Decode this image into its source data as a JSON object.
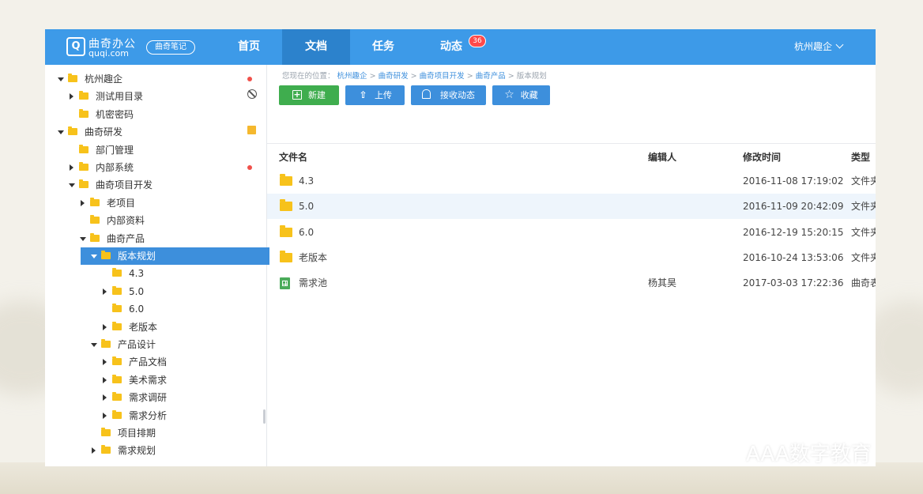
{
  "app": {
    "logo_mark": "Q",
    "logo_text": "曲奇办公",
    "logo_subtext": "quqi.com",
    "note_label": "曲奇笔记"
  },
  "nav": {
    "home": "首页",
    "docs": "文档",
    "tasks": "任务",
    "activity": "动态",
    "activity_badge": "36",
    "user": "杭州趣企"
  },
  "tree": [
    {
      "label": "杭州趣企",
      "caret": "down",
      "flag": "dot"
    },
    {
      "label": "测试用目录",
      "caret": "right",
      "flag": "ban"
    },
    {
      "label": "机密密码",
      "caret": "none",
      "flag": ""
    },
    {
      "label": "曲奇研发",
      "caret": "down",
      "flag": "edit"
    },
    {
      "label": "部门管理",
      "caret": "none",
      "flag": ""
    },
    {
      "label": "内部系统",
      "caret": "right",
      "flag": "dot"
    },
    {
      "label": "曲奇项目开发",
      "caret": "down",
      "flag": ""
    },
    {
      "label": "老项目",
      "caret": "right",
      "flag": ""
    },
    {
      "label": "内部资料",
      "caret": "none",
      "flag": ""
    },
    {
      "label": "曲奇产品",
      "caret": "down",
      "flag": ""
    },
    {
      "label": "版本规划",
      "caret": "down",
      "flag": "",
      "selected": true
    },
    {
      "label": "4.3",
      "caret": "none",
      "flag": ""
    },
    {
      "label": "5.0",
      "caret": "right",
      "flag": ""
    },
    {
      "label": "6.0",
      "caret": "none",
      "flag": ""
    },
    {
      "label": "老版本",
      "caret": "right",
      "flag": ""
    },
    {
      "label": "产品设计",
      "caret": "down",
      "flag": ""
    },
    {
      "label": "产品文档",
      "caret": "right",
      "flag": ""
    },
    {
      "label": "美术需求",
      "caret": "right",
      "flag": ""
    },
    {
      "label": "需求调研",
      "caret": "right",
      "flag": ""
    },
    {
      "label": "需求分析",
      "caret": "right",
      "flag": ""
    },
    {
      "label": "项目排期",
      "caret": "none",
      "flag": ""
    },
    {
      "label": "需求规划",
      "caret": "right",
      "flag": ""
    }
  ],
  "breadcrumb": {
    "prefix": "您现在的位置：",
    "items": [
      "杭州趣企",
      "曲奇研发",
      "曲奇项目开发",
      "曲奇产品"
    ],
    "current": "版本规划",
    "separator": ">"
  },
  "toolbar": {
    "new": "新建",
    "upload": "上传",
    "subscribe": "接收动态",
    "favorite": "收藏"
  },
  "table": {
    "headers": {
      "name": "文件名",
      "editor": "编辑人",
      "time": "修改时间",
      "type": "类型"
    },
    "rows": [
      {
        "icon": "folder-icon",
        "name": "4.3",
        "editor": "",
        "time": "2016-11-08 17:19:02",
        "type": "文件夹"
      },
      {
        "icon": "folder-icon",
        "name": "5.0",
        "editor": "",
        "time": "2016-11-09 20:42:09",
        "type": "文件夹"
      },
      {
        "icon": "folder-icon",
        "name": "6.0",
        "editor": "",
        "time": "2016-12-19 15:20:15",
        "type": "文件夹"
      },
      {
        "icon": "folder-icon",
        "name": "老版本",
        "editor": "",
        "time": "2016-10-24 13:53:06",
        "type": "文件夹"
      },
      {
        "icon": "spreadsheet-icon",
        "name": "需求池",
        "editor": "杨其昊",
        "time": "2017-03-03 17:22:36",
        "type": "曲奇表"
      }
    ]
  },
  "watermark": "AAA数字教育",
  "colors": {
    "nav_bg": "#3d9ae8",
    "nav_active": "#2c82cc",
    "selected_row": "#3d8fdc",
    "green_button": "#3fad4e",
    "folder": "#f7c21b"
  }
}
